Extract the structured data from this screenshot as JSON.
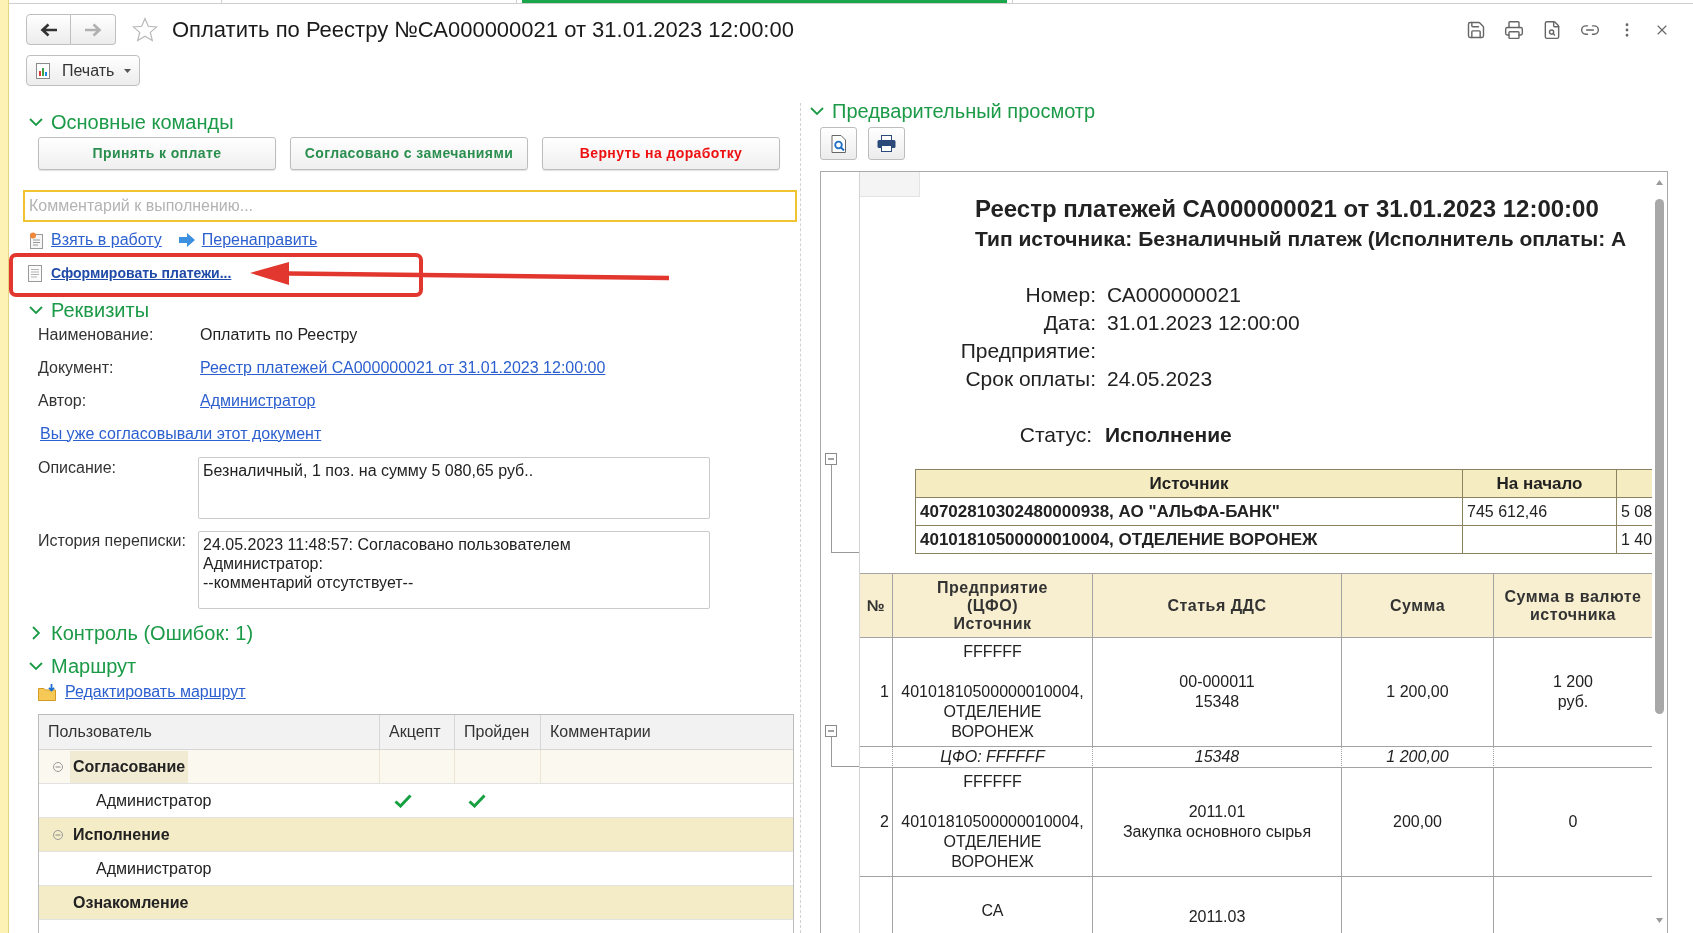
{
  "window": {
    "title": "Оплатить по Реестру №СА000000021 от 31.01.2023 12:00:00",
    "favorite": false
  },
  "nav": [
    {
      "kind": "back",
      "disabled": false
    },
    {
      "kind": "forward",
      "disabled": true
    }
  ],
  "window_actions": [
    {
      "kind": "save"
    },
    {
      "kind": "print"
    },
    {
      "kind": "preview"
    },
    {
      "kind": "link"
    },
    {
      "kind": "more"
    },
    {
      "kind": "close"
    }
  ],
  "print_menu": {
    "label": "Печать"
  },
  "main_commands": {
    "title": "Основные команды",
    "expanded": true,
    "buttons": [
      {
        "label": "Принять к оплате",
        "color": "#2a8f4e"
      },
      {
        "label": "Согласовано с замечаниями",
        "color": "#2a8f4e"
      },
      {
        "label": "Вернуть на доработку",
        "color": "#ee1111"
      }
    ],
    "comment": {
      "placeholder": "Комментарий к выполнению..."
    },
    "actions": [
      [
        {
          "kind": "take",
          "label": "Взять в работу"
        },
        {
          "kind": "redirect",
          "label": "Перенаправить"
        }
      ],
      [
        {
          "kind": "generate",
          "label": "Сформировать платежи..."
        }
      ]
    ]
  },
  "details": {
    "title": "Реквизиты",
    "expanded": true,
    "fields": [
      {
        "label": "Наименование:",
        "value": "Оплатить по Реестру",
        "kind": "text"
      },
      {
        "label": "Документ:",
        "value": "Реестр платежей СА000000021 от 31.01.2023 12:00:00",
        "kind": "link"
      },
      {
        "label": "Автор:",
        "value": "Администратор",
        "kind": "link"
      }
    ],
    "notice_link": "Вы уже согласовывали этот документ",
    "description": {
      "label": "Описание:",
      "value": "Безналичный, 1 поз. на сумму 5 080,65 руб.."
    },
    "history": {
      "label": "История переписки:",
      "value": "24.05.2023 11:48:57: Согласовано пользователем\nАдминистратор:\n--комментарий отсутствует--"
    }
  },
  "control": {
    "title": "Контроль (Ошибок: 1)",
    "expanded": false
  },
  "route": {
    "title": "Маршрут",
    "expanded": true,
    "edit_link": "Редактировать маршрут",
    "table": {
      "columns": [
        "Пользователь",
        "Акцепт",
        "Пройден",
        "Комментарии"
      ],
      "rows": [
        {
          "name": "Согласование",
          "expanded": true,
          "selected": true,
          "children": [
            {
              "name": "Администратор",
              "accepted": true,
              "passed": true,
              "selected": false
            }
          ]
        },
        {
          "name": "Исполнение",
          "expanded": true,
          "selected": false,
          "children": [
            {
              "name": "Администратор",
              "accepted": false,
              "passed": false,
              "selected": false
            }
          ]
        },
        {
          "name": "Ознакомление",
          "selected": false
        }
      ]
    }
  },
  "preview": {
    "title": "Предварительный просмотр",
    "expanded": true,
    "tools": [
      {
        "kind": "preview"
      },
      {
        "kind": "print"
      }
    ],
    "document": {
      "heading": "Реестр платежей СА000000021 от 31.01.2023 12:00:00",
      "subheading": "Тип источника: Безналичный платеж (Исполнитель оплаты: А",
      "fields": [
        {
          "label": "Номер:",
          "value": "СА000000021"
        },
        {
          "label": "Дата:",
          "value": "31.01.2023 12:00:00"
        },
        {
          "label": "Предприятие:"
        },
        {
          "label": "Срок оплаты:",
          "value": "24.05.2023"
        }
      ],
      "status": {
        "label": "Статус:",
        "value": "Исполнение"
      },
      "sources": {
        "columns": [
          "Источник",
          "На начало"
        ],
        "rows": [
          {
            "source": "40702810302480000938, АО \"АЛЬФА-БАНК\"",
            "opening": "745 612,46",
            "column_3": "5 08"
          },
          {
            "source": "40101810500000010004, ОТДЕЛЕНИЕ ВОРОНЕЖ",
            "column_3": "1 40"
          }
        ]
      },
      "payments": {
        "columns": [
          "№",
          "Предприятие\n(ЦФО)\nИсточник",
          "Статья ДДС",
          "Сумма",
          "Сумма в валюте\nисточника"
        ],
        "rows": [
          {
            "kind": "item",
            "number": "1",
            "enterprise": "FFFFFF\n\n40101810500000010004,\nОТДЕЛЕНИЕ\nВОРОНЕЖ",
            "article": "00-000011\n15348",
            "amount": "1 200,00",
            "amount_source": "1 200\nруб."
          },
          {
            "kind": "subtotal",
            "enterprise": "ЦФО: FFFFFF",
            "article": "15348",
            "amount": "1 200,00"
          },
          {
            "kind": "item",
            "number": "2",
            "enterprise": "FFFFFF\n\n40101810500000010004,\nОТДЕЛЕНИЕ\nВОРОНЕЖ",
            "article": "2011.01\nЗакупка основного сырья",
            "amount": "200,00",
            "amount_source": "0"
          },
          {
            "kind": "partial",
            "enterprise": "СА",
            "article": "2011.03"
          }
        ]
      }
    }
  }
}
